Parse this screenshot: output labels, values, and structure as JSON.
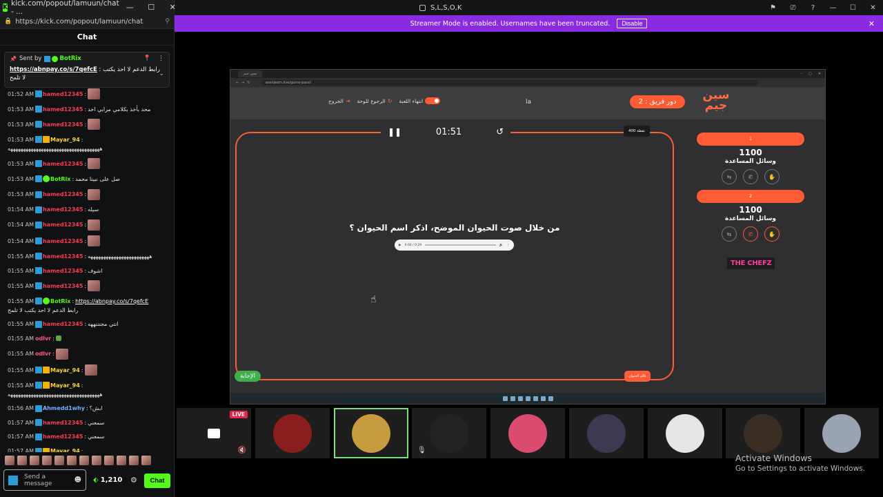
{
  "chat_window": {
    "tab_title": "kick.com/popout/lamuun/chat - ...",
    "url": "https://kick.com/popout/lamuun/chat",
    "header": "Chat",
    "window_controls": [
      "—",
      "☐",
      "✕"
    ]
  },
  "pinned": {
    "sent_by": "Sent by",
    "bot": "BotRix",
    "link": "https://abnpay.co/s/7qefcE",
    "message": "رابط الدعم لا احد يكتب :",
    "message2": "لا تلمح"
  },
  "messages": [
    {
      "time": "01:52 AM",
      "user": "hamed12345",
      "color": "red",
      "badges": [
        "mod"
      ],
      "text": "",
      "emote": true
    },
    {
      "time": "01:53 AM",
      "user": "hamed12345",
      "color": "red",
      "badges": [
        "mod"
      ],
      "text": "محد بأخذ بكلامي مرابي احد",
      "emote": false
    },
    {
      "time": "01:53 AM",
      "user": "hamed12345",
      "color": "red",
      "badges": [
        "mod"
      ],
      "text": "",
      "emote": true
    },
    {
      "time": "01:53 AM",
      "user": "Mayar_94",
      "color": "yel",
      "badges": [
        "mod",
        "sub"
      ],
      "text": "",
      "emote": false,
      "second": "ههههههههههههههههههههههههههههههههههههه"
    },
    {
      "time": "01:53 AM",
      "user": "hamed12345",
      "color": "red",
      "badges": [
        "mod"
      ],
      "text": "",
      "emote": true
    },
    {
      "time": "01:53 AM",
      "user": "BotRix",
      "color": "grn",
      "badges": [
        "mod",
        "ver"
      ],
      "text": "صل على نبينا محمد",
      "emote": false
    },
    {
      "time": "01:53 AM",
      "user": "hamed12345",
      "color": "red",
      "badges": [
        "mod"
      ],
      "text": "",
      "emote": true
    },
    {
      "time": "01:54 AM",
      "user": "hamed12345",
      "color": "red",
      "badges": [
        "mod"
      ],
      "text": "سيله",
      "emote": false
    },
    {
      "time": "01:54 AM",
      "user": "hamed12345",
      "color": "red",
      "badges": [
        "mod"
      ],
      "text": "",
      "emote": true
    },
    {
      "time": "01:54 AM",
      "user": "hamed12345",
      "color": "red",
      "badges": [
        "mod"
      ],
      "text": "",
      "emote": true
    },
    {
      "time": "01:55 AM",
      "user": "hamed12345",
      "color": "red",
      "badges": [
        "mod"
      ],
      "text": "ههههههههههههههههههههههههه",
      "emote": false
    },
    {
      "time": "01:55 AM",
      "user": "hamed12345",
      "color": "red",
      "badges": [
        "mod"
      ],
      "text": "اشوف",
      "emote": false
    },
    {
      "time": "01:55 AM",
      "user": "hamed12345",
      "color": "red",
      "badges": [
        "mod"
      ],
      "text": "",
      "emote": true
    },
    {
      "time": "01:55 AM",
      "user": "BotRix",
      "color": "grn",
      "badges": [
        "mod",
        "ver"
      ],
      "text": "",
      "link": "https://abnpay.co/s/7qefcE",
      "emote": false,
      "second": "رابط الدعم لا احد يكتب لا تلمح"
    },
    {
      "time": "01:55 AM",
      "user": "hamed12345",
      "color": "red",
      "badges": [
        "mod"
      ],
      "text": "انتي مجنننههه",
      "emote": false
    },
    {
      "time": "01:55 AM",
      "user": "odlvr",
      "color": "pnk",
      "badges": [],
      "text": "",
      "emote": "small"
    },
    {
      "time": "01:55 AM",
      "user": "odlvr",
      "color": "pnk",
      "badges": [],
      "text": "",
      "emote": true
    },
    {
      "time": "01:55 AM",
      "user": "Mayar_94",
      "color": "yel",
      "badges": [
        "mod",
        "sub"
      ],
      "text": "",
      "emote": true
    },
    {
      "time": "01:55 AM",
      "user": "Mayar_94",
      "color": "yel",
      "badges": [
        "mod",
        "sub"
      ],
      "text": "",
      "emote": false,
      "second": "ههههههههههههههههههههههههههههههههههههه"
    },
    {
      "time": "01:56 AM",
      "user": "Ahmedd1why",
      "color": "blu",
      "badges": [
        "mod"
      ],
      "text": "ابش؟",
      "emote": false
    },
    {
      "time": "01:57 AM",
      "user": "hamed12345",
      "color": "red",
      "badges": [
        "mod"
      ],
      "text": "سمعني",
      "emote": false
    },
    {
      "time": "01:57 AM",
      "user": "hamed12345",
      "color": "red",
      "badges": [
        "mod"
      ],
      "text": "سمعني",
      "emote": false
    },
    {
      "time": "01:57 AM",
      "user": "Mayar_94",
      "color": "yel",
      "badges": [
        "mod",
        "sub"
      ],
      "text": "",
      "emote": false,
      "second": "ههههههههههههههههههههههههههههههههههههه"
    }
  ],
  "chat_input": {
    "placeholder": "Send a message",
    "points": "1,210",
    "send_label": "Chat"
  },
  "main": {
    "window_title": "S,L,S,O,K",
    "banner_text": "Streamer Mode is enabled. Usernames have been truncated.",
    "banner_button": "Disable",
    "banner_close": "✕"
  },
  "game": {
    "tab_title": "سين جيم",
    "url": "seenjeem.live/game-panel",
    "logo": "سين جيم",
    "turn_label": "دور فريق : 2",
    "letter": "la",
    "nav_end": "انتهاء اللعبة",
    "nav_board": "الرجوع للوحة",
    "nav_exit": "الخروج",
    "timer": "01:51",
    "points_tag": "400 نقطة",
    "question": "من خلال صوت الحيوان الموضح، اذكر اسم الحيوان ؟",
    "audio_time": "0:00 / 0:29",
    "audio_progress": 0,
    "answer_button": "الإجابة",
    "category_button": "عالم الحيوان",
    "teams": [
      {
        "name": "1",
        "score": "1100",
        "aids_label": "وسائل المساعدة",
        "aids": [
          "swap",
          "call",
          "hand"
        ],
        "active": []
      },
      {
        "name": "2",
        "score": "1100",
        "aids_label": "وسائل المساعدة",
        "aids": [
          "swap",
          "call",
          "hand"
        ],
        "active": [
          "call",
          "hand"
        ]
      }
    ],
    "sponsor": "THE CHEFZ"
  },
  "thumbnails": [
    {
      "name": "thumb-1",
      "live": "LIVE",
      "color": "#2b2b2b",
      "selected": false
    },
    {
      "name": "thumb-2",
      "color": "#8b1e1e",
      "selected": false
    },
    {
      "name": "thumb-3",
      "color": "#c79c3e",
      "selected": true
    },
    {
      "name": "thumb-4",
      "color": "#232323",
      "selected": false
    },
    {
      "name": "thumb-5",
      "color": "#d94b6f",
      "selected": false
    },
    {
      "name": "thumb-6",
      "color": "#3c3a52",
      "selected": false
    },
    {
      "name": "thumb-7",
      "color": "#e6e6e6",
      "selected": false
    },
    {
      "name": "thumb-8",
      "color": "#3a2d22",
      "selected": false
    },
    {
      "name": "thumb-9",
      "color": "#9aa3b3",
      "selected": false
    }
  ],
  "watermark": {
    "line1": "Activate Windows",
    "line2": "Go to Settings to activate Windows."
  }
}
